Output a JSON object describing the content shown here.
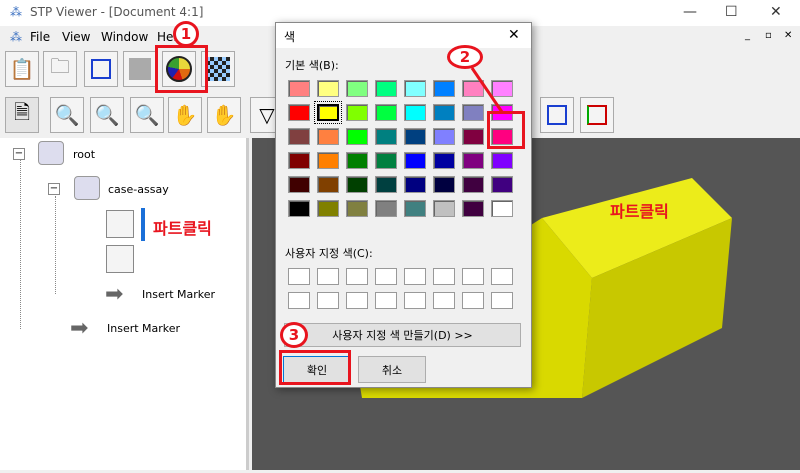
{
  "window": {
    "title": "STP Viewer - [Document 4:1]",
    "minimize": "—",
    "maximize": "☐",
    "close": "✕"
  },
  "menu": {
    "items": [
      "File",
      "View",
      "Window",
      "Help"
    ],
    "mdi_buttons": [
      "_",
      "▫",
      "✕"
    ]
  },
  "tree": {
    "root": "root",
    "assembly": "case-assay",
    "marker1": "Insert Marker",
    "marker2": "Insert Marker",
    "expand": "−"
  },
  "annotations": {
    "step1": "1",
    "step2": "2",
    "step3": "3",
    "part_click_tree": "파트클릭",
    "part_click_view": "파트클릭"
  },
  "dialog": {
    "title": "색",
    "close": "✕",
    "basic_label": "기본 색(B):",
    "custom_label": "사용자 지정 색(C):",
    "define_button": "사용자 지정 색 만들기(D) >>",
    "ok": "확인",
    "cancel": "취소",
    "basic_colors": [
      [
        "#FF8080",
        "#FFFF80",
        "#80FF80",
        "#00FF80",
        "#80FFFF",
        "#0080FF",
        "#FF80C0",
        "#FF80FF"
      ],
      [
        "#FF0000",
        "#FFFF00",
        "#80FF00",
        "#00FF40",
        "#00FFFF",
        "#0080C0",
        "#8080C0",
        "#FF00FF"
      ],
      [
        "#804040",
        "#FF8040",
        "#00FF00",
        "#008080",
        "#004080",
        "#8080FF",
        "#800040",
        "#FF0080"
      ],
      [
        "#800000",
        "#FF8000",
        "#008000",
        "#008040",
        "#0000FF",
        "#0000A0",
        "#800080",
        "#8000FF"
      ],
      [
        "#400000",
        "#804000",
        "#004000",
        "#004040",
        "#000080",
        "#000040",
        "#400040",
        "#400080"
      ],
      [
        "#000000",
        "#808000",
        "#808040",
        "#808080",
        "#408080",
        "#C0C0C0",
        "#400040",
        "#FFFFFF"
      ]
    ],
    "selected": "#FFFF00",
    "highlighted": "#FF0080"
  },
  "colors": {
    "annotation": "#E8141E",
    "model": "#E6E600",
    "viewport": "#555555"
  }
}
